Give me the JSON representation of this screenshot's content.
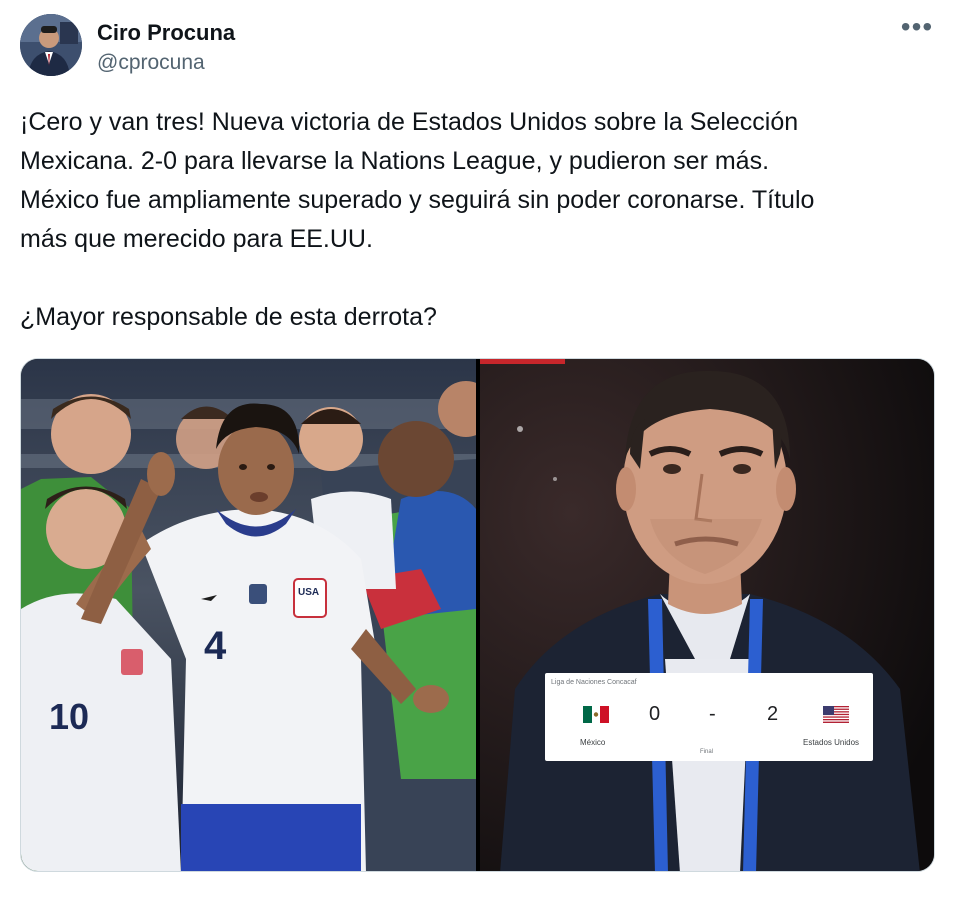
{
  "tweet": {
    "author": {
      "display_name": "Ciro Procuna",
      "handle": "@cprocuna"
    },
    "more_icon": "more-horizontal-icon",
    "text_paragraphs": [
      "¡Cero y van tres! Nueva victoria de Estados Unidos sobre la Selección",
      "Mexicana. 2-0 para llevarse la Nations League, y pudieron ser más.",
      "México fue ampliamente superado y seguirá sin poder coronarse. Título",
      "más que merecido para EE.UU.",
      "¿Mayor responsable de esta derrota?"
    ]
  },
  "media": {
    "left_photo": {
      "jersey_number": "4",
      "second_jersey_number": "10",
      "crest_text": "USA"
    },
    "scoreboard": {
      "title": "Liga de Naciones Concacaf",
      "home_team": "México",
      "away_team": "Estados Unidos",
      "home_score": "0",
      "separator": "-",
      "away_score": "2",
      "status": "Final"
    }
  },
  "colors": {
    "text": "#0f1419",
    "secondary_text": "#536471",
    "border": "#cfd9de"
  }
}
